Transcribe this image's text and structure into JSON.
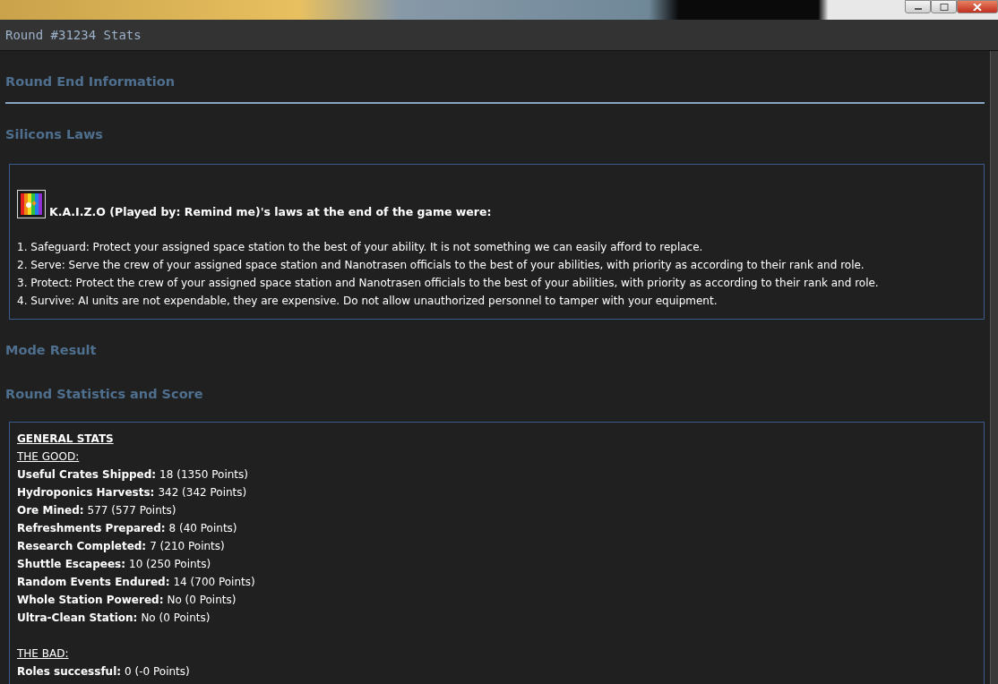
{
  "window": {
    "title": "Round #31234 Stats"
  },
  "sections": [
    {
      "kind": "rule",
      "heading": "Round End Information"
    },
    {
      "kind": "laws",
      "heading": "Silicons Laws",
      "laws_box": {
        "owner_line": "K.A.I.Z.O (Played by: Remind me)'s laws at the end of the game were:",
        "laws": [
          "1. Safeguard: Protect your assigned space station to the best of your ability. It is not something we can easily afford to replace.",
          "2. Serve: Serve the crew of your assigned space station and Nanotrasen officials to the best of your abilities, with priority as according to their rank and role.",
          "3. Protect: Protect the crew of your assigned space station and Nanotrasen officials to the best of your abilities, with priority as according to their rank and role.",
          "4. Survive: AI units are not expendable, they are expensive. Do not allow unauthorized personnel to tamper with your equipment."
        ]
      }
    },
    {
      "kind": "plain",
      "heading": "Mode Result"
    },
    {
      "kind": "stats",
      "heading": "Round Statistics and Score",
      "stats_box": {
        "title": "GENERAL STATS",
        "groups": [
          {
            "heading": "THE GOOD:",
            "items": [
              {
                "label": "Useful Crates Shipped:",
                "value": "18 (1350 Points)"
              },
              {
                "label": "Hydroponics Harvests:",
                "value": "342 (342 Points)"
              },
              {
                "label": "Ore Mined:",
                "value": "577 (577 Points)"
              },
              {
                "label": "Refreshments Prepared:",
                "value": "8 (40 Points)"
              },
              {
                "label": "Research Completed:",
                "value": "7 (210 Points)"
              },
              {
                "label": "Shuttle Escapees:",
                "value": "10 (250 Points)"
              },
              {
                "label": "Random Events Endured:",
                "value": "14 (700 Points)"
              },
              {
                "label": "Whole Station Powered:",
                "value": "No (0 Points)"
              },
              {
                "label": "Ultra-Clean Station:",
                "value": "No (0 Points)"
              }
            ]
          },
          {
            "heading": "THE BAD:",
            "items": [
              {
                "label": "Roles successful:",
                "value": "0 (-0 Points)"
              }
            ]
          }
        ]
      }
    }
  ]
}
